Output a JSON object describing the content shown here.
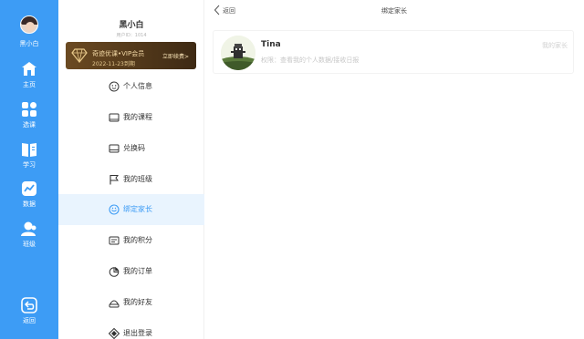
{
  "rail": {
    "user_label": "黑小白",
    "items": [
      {
        "label": "主页",
        "icon": "home-icon"
      },
      {
        "label": "选课",
        "icon": "grid-icon"
      },
      {
        "label": "学习",
        "icon": "book-icon"
      },
      {
        "label": "数据",
        "icon": "chart-icon"
      },
      {
        "label": "班级",
        "icon": "people-icon"
      },
      {
        "label": "返回",
        "icon": "back-icon"
      }
    ]
  },
  "profile": {
    "name": "黑小白",
    "user_id": "用户ID：1014"
  },
  "vip": {
    "title": "奇迹优课•VIP会员",
    "expire": "2022-11-23到期",
    "renew": "立即续费>"
  },
  "menu": [
    {
      "label": "个人信息",
      "icon": "user-circle-icon"
    },
    {
      "label": "我的课程",
      "icon": "course-icon"
    },
    {
      "label": "兑换码",
      "icon": "redeem-icon"
    },
    {
      "label": "我的班级",
      "icon": "flag-icon"
    },
    {
      "label": "绑定家长",
      "icon": "bind-parent-icon"
    },
    {
      "label": "我的积分",
      "icon": "points-icon"
    },
    {
      "label": "我的订单",
      "icon": "order-icon"
    },
    {
      "label": "我的好友",
      "icon": "friends-icon"
    },
    {
      "label": "退出登录",
      "icon": "logout-icon"
    }
  ],
  "topbar": {
    "back_label": "返回",
    "title": "绑定家长"
  },
  "parent_card": {
    "name": "Tina",
    "permission": "权限：查看我的个人数据/接收日报",
    "role": "我的家长"
  },
  "colors": {
    "accent": "#3d9cf5",
    "vip_bg": "#5a3d1c",
    "active_bg": "#e9f4fe"
  }
}
